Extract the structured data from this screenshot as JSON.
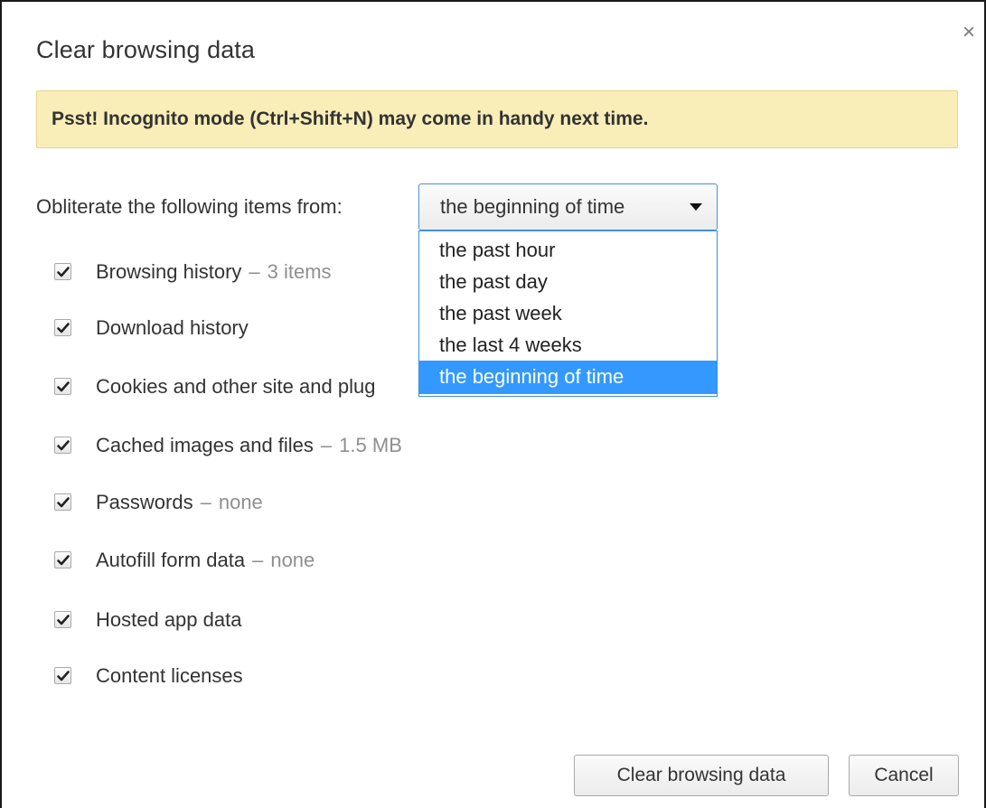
{
  "dialog": {
    "title": "Clear browsing data",
    "close_glyph": "×",
    "close_icon": "close-icon"
  },
  "banner": {
    "text": "Psst! Incognito mode (Ctrl+Shift+N) may come in handy next time.",
    "background_color": "#f9eeb8"
  },
  "obliterate": {
    "label": "Obliterate the following items from:",
    "selected": "the beginning of time",
    "options": [
      "the past hour",
      "the past day",
      "the past week",
      "the last 4 weeks",
      "the beginning of time"
    ],
    "highlight_color": "#3399ff"
  },
  "items": [
    {
      "label": "Browsing history",
      "detail": "3 items",
      "checked": true
    },
    {
      "label": "Download history",
      "detail": "",
      "checked": true
    },
    {
      "label": "Cookies and other site and plug",
      "detail": "",
      "checked": true
    },
    {
      "label": "Cached images and files",
      "detail": "1.5 MB",
      "checked": true
    },
    {
      "label": "Passwords",
      "detail": "none",
      "checked": true
    },
    {
      "label": "Autofill form data",
      "detail": "none",
      "checked": true
    },
    {
      "label": "Hosted app data",
      "detail": "",
      "checked": true
    },
    {
      "label": "Content licenses",
      "detail": "",
      "checked": true
    }
  ],
  "separator": "–",
  "buttons": {
    "clear_label": "Clear browsing data",
    "cancel_label": "Cancel"
  }
}
